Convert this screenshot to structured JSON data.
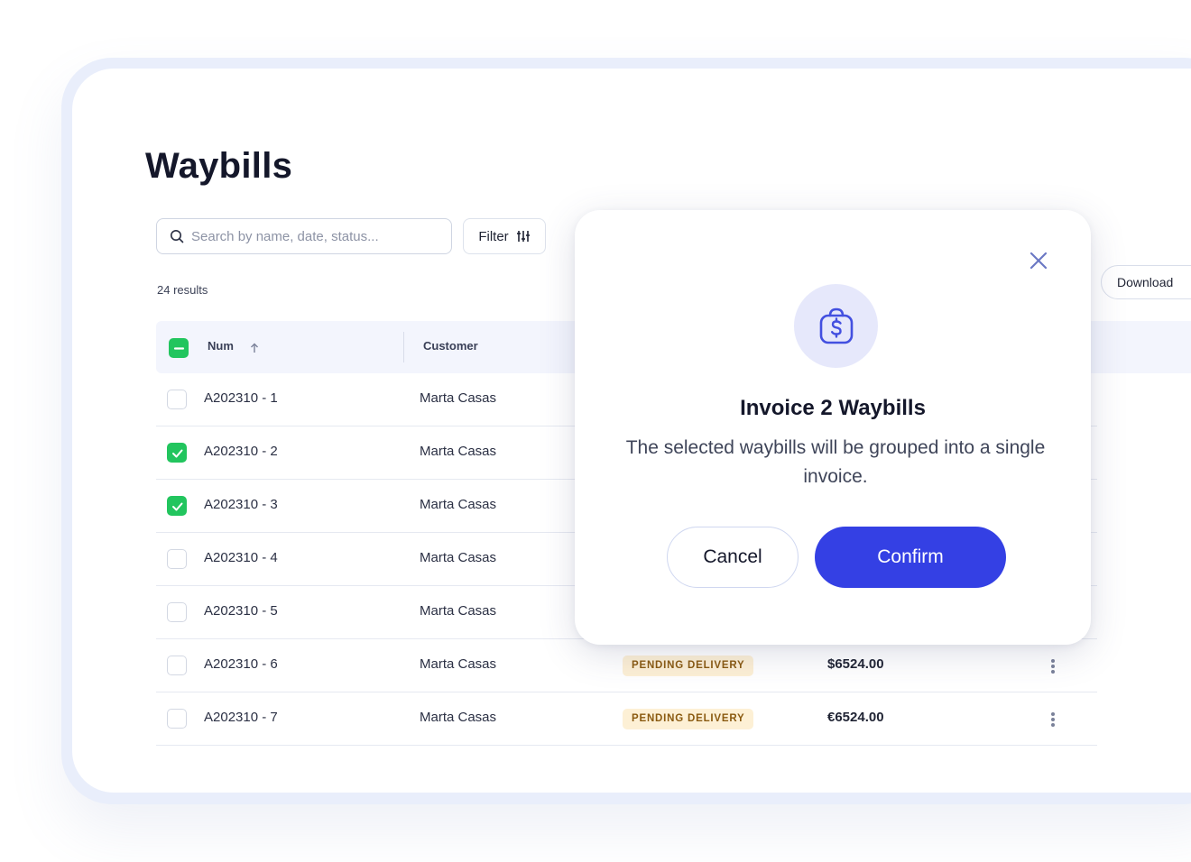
{
  "page": {
    "title": "Waybills",
    "results_label": "24 results"
  },
  "toolbar": {
    "search_placeholder": "Search by name, date, status...",
    "filter_label": "Filter",
    "download_label": "Download"
  },
  "table": {
    "columns": [
      "Num",
      "Customer"
    ],
    "rows": [
      {
        "num": "A202310 - 1",
        "customer": "Marta Casas",
        "checked": false
      },
      {
        "num": "A202310 - 2",
        "customer": "Marta Casas",
        "checked": true
      },
      {
        "num": "A202310 - 3",
        "customer": "Marta Casas",
        "checked": true
      },
      {
        "num": "A202310 - 4",
        "customer": "Marta Casas",
        "checked": false
      },
      {
        "num": "A202310 - 5",
        "customer": "Marta Casas",
        "checked": false
      },
      {
        "num": "A202310 - 6",
        "customer": "Marta Casas",
        "status": "PENDING DELIVERY",
        "amount": "$6524.00",
        "checked": false
      },
      {
        "num": "A202310 - 7",
        "customer": "Marta Casas",
        "status": "PENDING DELIVERY",
        "amount": "€6524.00",
        "checked": false
      }
    ]
  },
  "modal": {
    "title": "Invoice 2 Waybills",
    "description": "The selected waybills will be grouped into a single invoice.",
    "cancel_label": "Cancel",
    "confirm_label": "Confirm",
    "icon": "money-bag-icon"
  },
  "colors": {
    "accent": "#3440e4",
    "check_green": "#22c55e",
    "badge_bg": "#fdf0d5",
    "badge_text": "#8a5a10",
    "header_bg": "#f3f5fd"
  }
}
